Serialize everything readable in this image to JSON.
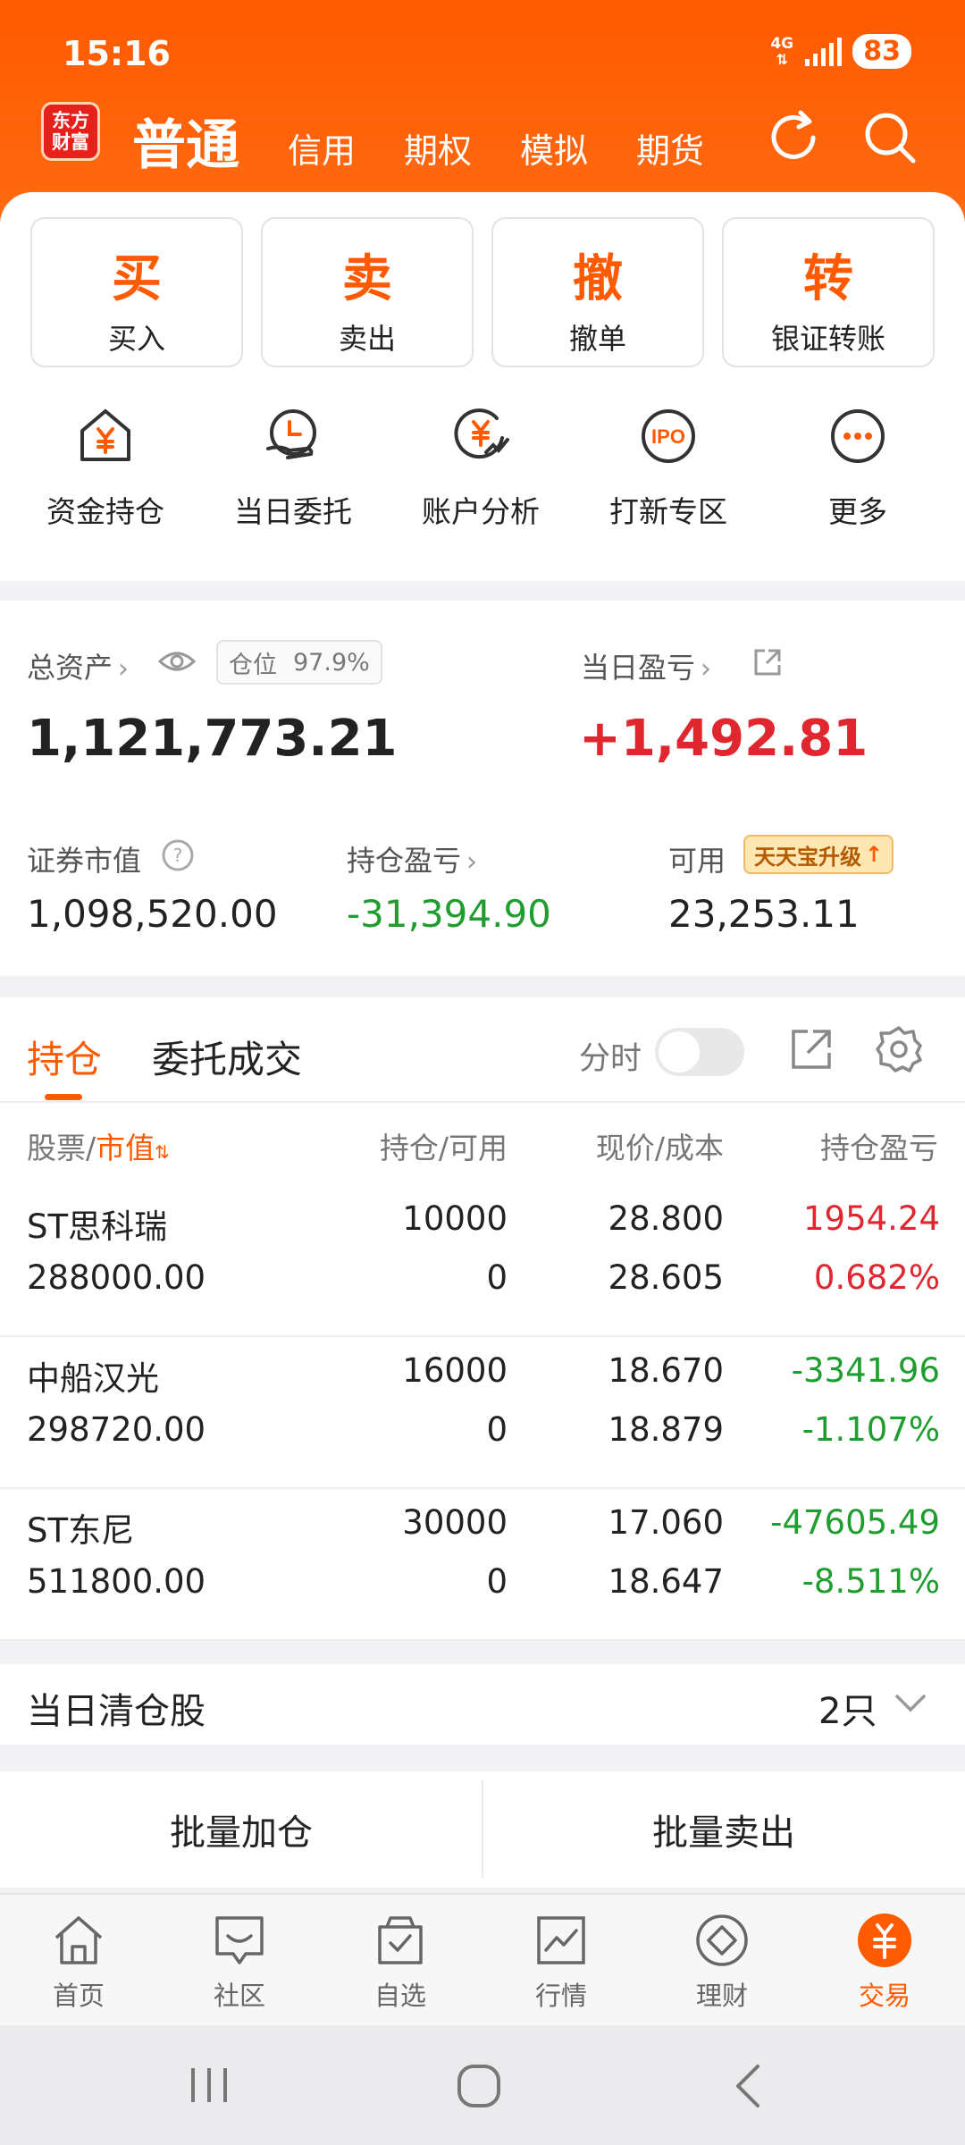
{
  "status": {
    "time": "15:16",
    "network": "4G",
    "battery": "83"
  },
  "nav": {
    "logo_line1": "东方",
    "logo_line2": "财富",
    "active_tab": "普通",
    "tabs": [
      "信用",
      "期权",
      "模拟",
      "期货"
    ]
  },
  "actions": [
    {
      "char": "买",
      "label": "买入"
    },
    {
      "char": "卖",
      "label": "卖出"
    },
    {
      "char": "撤",
      "label": "撤单"
    },
    {
      "char": "转",
      "label": "银证转账"
    }
  ],
  "quick": [
    {
      "label": "资金持仓",
      "icon": "house-yen-icon"
    },
    {
      "label": "当日委托",
      "icon": "hand-clock-icon"
    },
    {
      "label": "账户分析",
      "icon": "yen-trend-icon"
    },
    {
      "label": "打新专区",
      "icon": "ipo-icon"
    },
    {
      "label": "更多",
      "icon": "more-icon",
      "glyph": "IPO"
    }
  ],
  "assets": {
    "total_label": "总资产",
    "position_label": "仓位",
    "position_value": "97.9%",
    "total_value": "1,121,773.21",
    "daily_pnl_label": "当日盈亏",
    "daily_pnl_value": "+1,492.81",
    "market_value_label": "证券市值",
    "market_value": "1,098,520.00",
    "holding_pnl_label": "持仓盈亏",
    "holding_pnl_value": "-31,394.90",
    "available_label": "可用",
    "upgrade_badge": "天天宝升级",
    "available_value": "23,253.11"
  },
  "holdings": {
    "tabs": [
      "持仓",
      "委托成交"
    ],
    "toggle_label": "分时",
    "headers": {
      "stock": "股票/",
      "stock_sort": "市值",
      "position": "持仓/可用",
      "price": "现价/成本",
      "pnl": "持仓盈亏"
    },
    "rows": [
      {
        "name": "ST思科瑞",
        "value": "288000.00",
        "position": "10000",
        "available": "0",
        "price": "28.800",
        "cost": "28.605",
        "pnl": "1954.24",
        "pnl_pct": "0.682%",
        "color": "#e0262f"
      },
      {
        "name": "中船汉光",
        "value": "298720.00",
        "position": "16000",
        "available": "0",
        "price": "18.670",
        "cost": "18.879",
        "pnl": "-3341.96",
        "pnl_pct": "-1.107%",
        "color": "#1f9d2f"
      },
      {
        "name": "ST东尼",
        "value": "511800.00",
        "position": "30000",
        "available": "0",
        "price": "17.060",
        "cost": "18.647",
        "pnl": "-47605.49",
        "pnl_pct": "-8.511%",
        "color": "#1f9d2f"
      }
    ]
  },
  "clearance": {
    "label": "当日清仓股",
    "count": "2只"
  },
  "batch": {
    "add": "批量加仓",
    "sell": "批量卖出"
  },
  "bottom_nav": [
    {
      "label": "首页",
      "icon": "home-icon"
    },
    {
      "label": "社区",
      "icon": "community-icon"
    },
    {
      "label": "自选",
      "icon": "watchlist-icon"
    },
    {
      "label": "行情",
      "icon": "market-icon"
    },
    {
      "label": "理财",
      "icon": "wealth-icon"
    },
    {
      "label": "交易",
      "icon": "trade-icon",
      "active": true
    }
  ],
  "colors": {
    "brand": "#ff5a00",
    "up": "#e0262f",
    "down": "#1f9d2f"
  }
}
